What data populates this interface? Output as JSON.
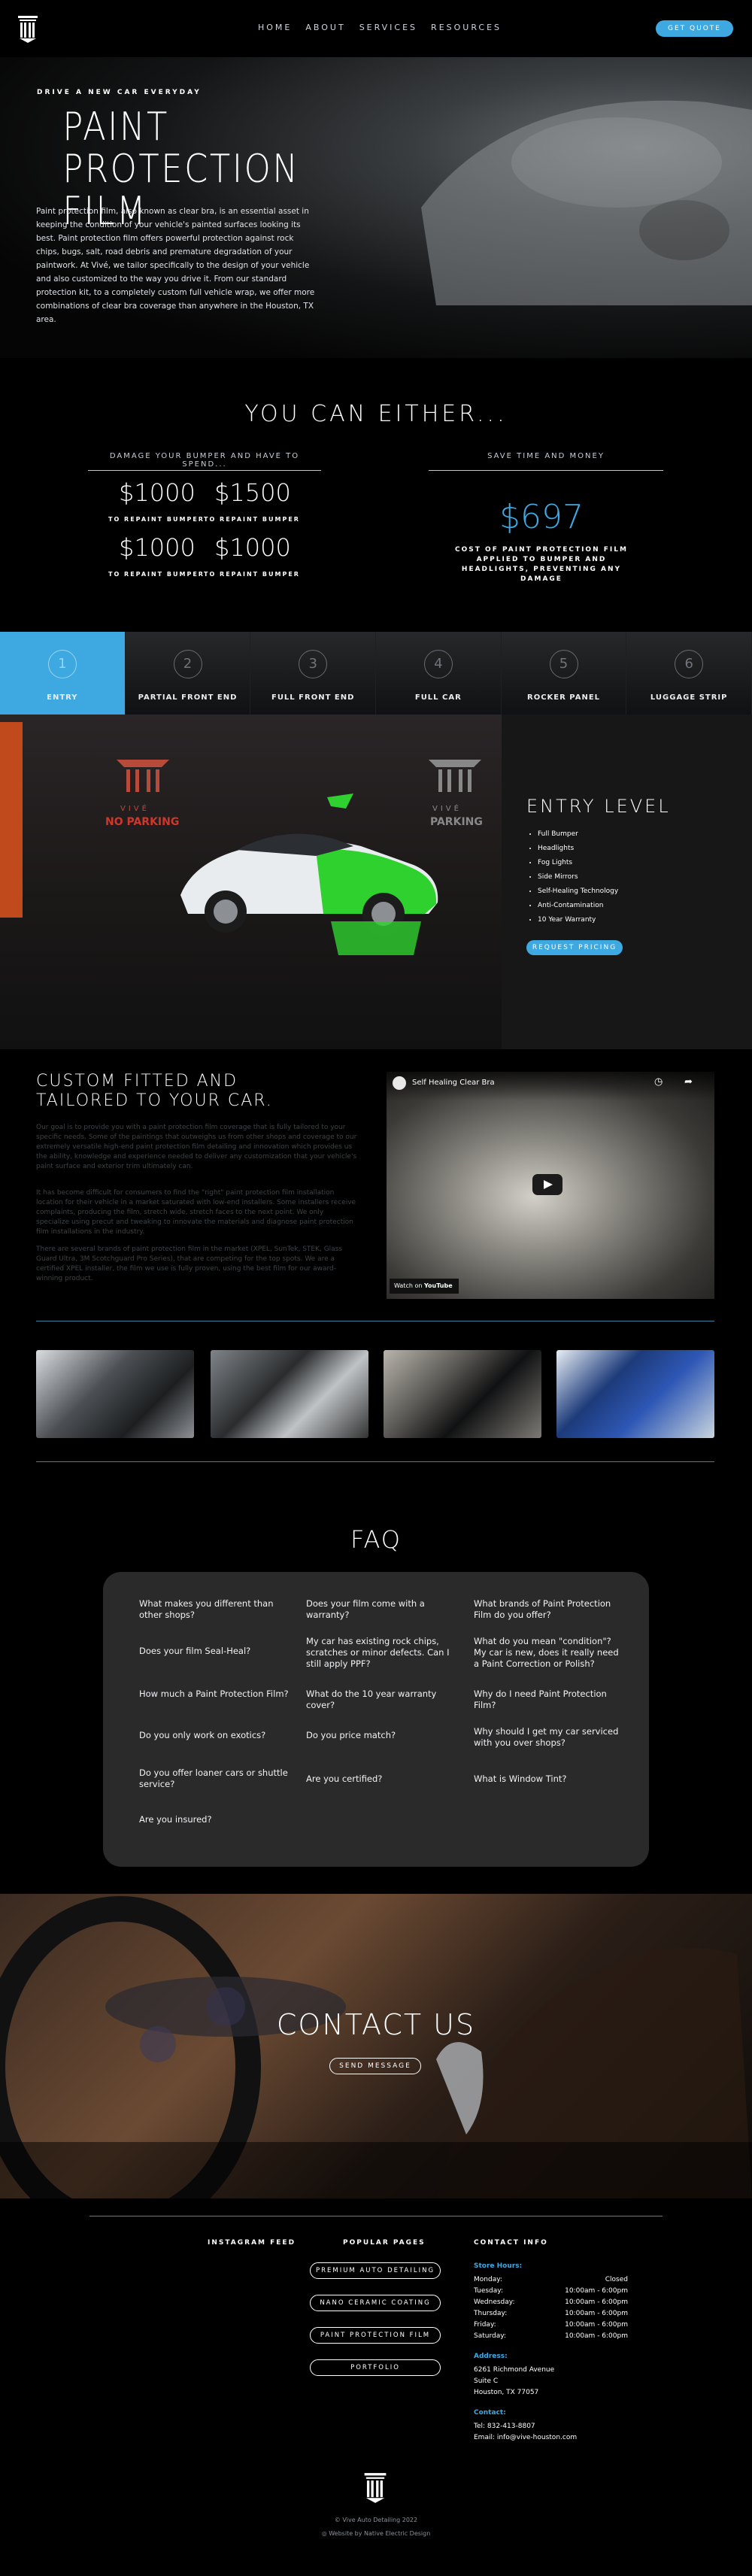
{
  "nav": {
    "items": [
      "HOME",
      "ABOUT",
      "SERVICES",
      "RESOURCES"
    ],
    "quote_label": "GET QUOTE"
  },
  "hero": {
    "kicker": "DRIVE A NEW CAR EVERYDAY",
    "title_line1": "PAINT PROTECTION",
    "title_line2": "FILM",
    "body": "Paint protection film, also known as clear bra, is an essential asset in keeping the condition of your vehicle's painted surfaces looking its best. Paint protection film offers powerful protection against rock chips, bugs, salt, road debris and premature degradation of your paintwork. At Vivé, we tailor specifically to the design of your vehicle and also customized to the way you drive it. From our standard protection kit, to a completely custom full vehicle wrap, we offer more combinations of clear bra coverage than anywhere in the Houston, TX area."
  },
  "either": {
    "title": "YOU CAN EITHER...",
    "left_head": "DAMAGE YOUR BUMPER AND HAVE TO SPEND...",
    "prices": [
      {
        "amount": "$1000",
        "sub": "TO REPAINT BUMPER"
      },
      {
        "amount": "$1500",
        "sub": "TO REPAINT BUMPER"
      },
      {
        "amount": "$1000",
        "sub": "TO REPAINT BUMPER"
      },
      {
        "amount": "$1000",
        "sub": "TO REPAINT BUMPER"
      }
    ],
    "right_head": "SAVE TIME AND MONEY",
    "save_price": "$697",
    "save_note": "COST OF PAINT PROTECTION FILM APPLIED TO BUMPER AND HEADLIGHTS, PREVENTING ANY DAMAGE"
  },
  "tabs": [
    {
      "num": "1",
      "label": "ENTRY"
    },
    {
      "num": "2",
      "label": "PARTIAL FRONT END"
    },
    {
      "num": "3",
      "label": "FULL FRONT END"
    },
    {
      "num": "4",
      "label": "FULL CAR"
    },
    {
      "num": "5",
      "label": "ROCKER PANEL"
    },
    {
      "num": "6",
      "label": "LUGGAGE STRIP"
    }
  ],
  "entry": {
    "sign_left": "VIVÉ",
    "sign_sub": "NO PARKING",
    "sign_right": "VIVÉ",
    "sign_right_sub": "PARKING",
    "title": "ENTRY LEVEL",
    "features": [
      "Full Bumper",
      "Headlights",
      "Fog Lights",
      "Side Mirrors",
      "Self-Healing Technology",
      "Anti-Contamination",
      "10 Year Warranty"
    ],
    "button": "REQUEST PRICING"
  },
  "custom": {
    "title": "CUSTOM FITTED AND TAILORED TO YOUR CAR.",
    "p1": "Our goal is to provide you with a paint protection film coverage that is fully tailored to your specific needs. Some of the paintings that outweighs us from other shops and coverage to our extremely versatile high-end paint protection film detailing and innovation which provides us the ability, knowledge and experience needed to deliver any customization that your vehicle's paint surface and exterior trim ultimately can.",
    "p2": "It has become difficult for consumers to find the \"right\" paint protection film installation location for their vehicle in a market saturated with low-end installers. Some installers receive complaints, producing the film, stretch wide, stretch faces to the next point. We only specialize using precut and tweaking to innovate the materials and diagnose paint protection film installations in the industry.",
    "p3": "There are several brands of paint protection film in the market (XPEL, SunTek, STEK, Glass Guard Ultra, 3M Scotchguard Pro Series), that are competing for the top spots. We are a certified XPEL installer, the film we use is fully proven, using the best film for our award-winning product.",
    "video_title": "Self Healing Clear Bra",
    "watch_label": "Watch on",
    "youtube_label": "YouTube"
  },
  "faq": {
    "title": "FAQ",
    "questions": [
      "What makes you different than other shops?",
      "Does your film come with a warranty?",
      "What brands of Paint Protection Film do you offer?",
      "Does your film Seal-Heal?",
      "My car has existing rock chips, scratches or minor defects. Can I still apply PPF?",
      "What do you mean \"condition\"? My car is new, does it really need a Paint Correction or Polish?",
      "How much a Paint Protection Film?",
      "What do the 10 year warranty cover?",
      "Why do I need Paint Protection Film?",
      "Do you only work on exotics?",
      "Do you price match?",
      "Why should I get my car serviced with you over shops?",
      "Do you offer loaner cars or shuttle service?",
      "Are you certified?",
      "What is Window Tint?",
      "Are you insured?"
    ]
  },
  "contact": {
    "title": "CONTACT US",
    "button": "SEND MESSAGE"
  },
  "footer": {
    "instagram_head": "INSTAGRAM FEED",
    "popular_head": "POPULAR PAGES",
    "contact_head": "CONTACT INFO",
    "pages": [
      "PREMIUM AUTO DETAILING",
      "NANO CERAMIC COATING",
      "PAINT PROTECTION FILM",
      "PORTFOLIO"
    ],
    "store_hours_label": "Store Hours:",
    "hours": [
      {
        "day": "Monday:",
        "time": "Closed"
      },
      {
        "day": "Tuesday:",
        "time": "10:00am - 6:00pm"
      },
      {
        "day": "Wednesday:",
        "time": "10:00am - 6:00pm"
      },
      {
        "day": "Thursday:",
        "time": "10:00am - 6:00pm"
      },
      {
        "day": "Friday:",
        "time": "10:00am - 6:00pm"
      },
      {
        "day": "Saturday:",
        "time": "10:00am - 6:00pm"
      }
    ],
    "address_label": "Address:",
    "address1": "6261 Richmond Avenue",
    "address2": "Suite C",
    "address3": "Houston, TX 77057",
    "contact_label": "Contact:",
    "tel": "Tel: 832-413-8807",
    "email": "Email: info@vive-houston.com",
    "copyright": "© Vive Auto Detailing 2022",
    "credit": "Website by Native Electric Design"
  },
  "colors": {
    "accent": "#3ea8e0",
    "background": "#000000",
    "ppf_green": "#2fd12f"
  },
  "icons": [
    "vive-logo-icon",
    "play-icon",
    "youtube-icon",
    "clock-icon",
    "share-icon"
  ]
}
